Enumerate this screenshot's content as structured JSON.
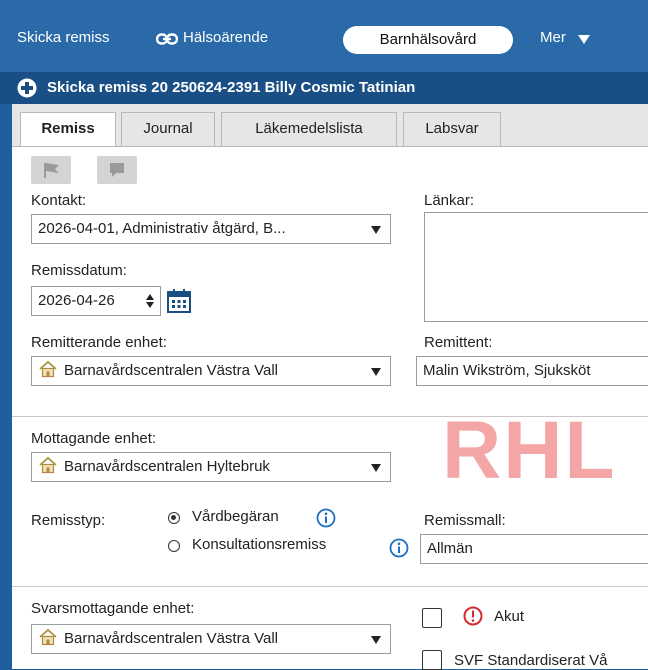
{
  "topbar": {
    "send_referral": "Skicka remiss",
    "health_matter": "Hälsoärende",
    "active_pill": "Barnhälsovård",
    "more": "Mer"
  },
  "titlebar": {
    "title": "Skicka remiss 20 250624-2391 Billy Cosmic Tatinian"
  },
  "tabs": [
    {
      "label": "Remiss"
    },
    {
      "label": "Journal"
    },
    {
      "label": "Läkemedelslista"
    },
    {
      "label": "Labsvar"
    }
  ],
  "form": {
    "contact_label": "Kontakt:",
    "contact_value": "2026-04-01, Administrativ åtgärd, B...",
    "links_label": "Länkar:",
    "referral_date_label": "Remissdatum:",
    "referral_date_value": "2026-04-26",
    "referring_unit_label": "Remitterande enhet:",
    "referring_unit_value": "Barnavårdscentralen Västra Vall",
    "referrer_label": "Remittent:",
    "referrer_value": "Malin Wikström, Sjuksköt",
    "receiving_unit_label": "Mottagande enhet:",
    "receiving_unit_value": "Barnavårdscentralen Hyltebruk",
    "referral_type_label": "Remisstyp:",
    "type_care_request": "Vårdbegäran",
    "type_consultation": "Konsultationsremiss",
    "template_label": "Remissmall:",
    "template_value": "Allmän",
    "reply_unit_label": "Svarsmottagande enhet:",
    "reply_unit_value": "Barnavårdscentralen Västra Vall",
    "urgent_label": "Akut",
    "svf_label": "SVF Standardiserat Vå"
  },
  "watermark": "RHL",
  "colors": {
    "topbar": "#2a6aa8",
    "titlebar": "#1a4f86",
    "accent": "#1a6fc0",
    "alert": "#d22b2b",
    "watermark": "#f4a6a6"
  }
}
